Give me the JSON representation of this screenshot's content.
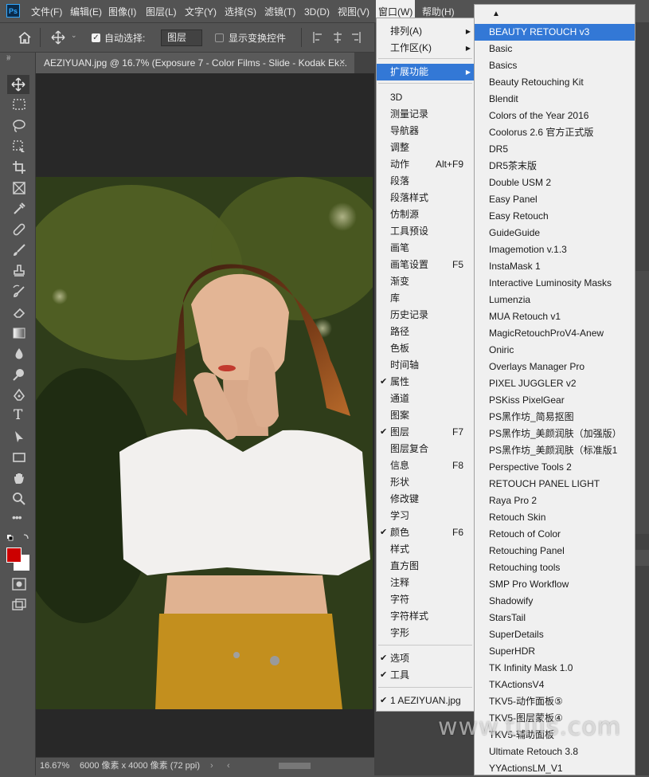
{
  "app": {
    "logo": "Ps"
  },
  "menubar": {
    "items": [
      "文件(F)",
      "编辑(E)",
      "图像(I)",
      "图层(L)",
      "文字(Y)",
      "选择(S)",
      "滤镜(T)",
      "3D(D)",
      "视图(V)",
      "窗口(W)",
      "帮助(H)"
    ],
    "active": "窗口(W)"
  },
  "options_bar": {
    "auto_select_label": "自动选择:",
    "auto_select_checked": true,
    "layer_select_value": "图层",
    "show_transform_label": "显示变换控件",
    "show_transform_checked": false
  },
  "document": {
    "tab_title": "AEZIYUAN.jpg @ 16.7% (Exposure 7 - Color Films - Slide - Kodak Ek...",
    "zoom": "16.67%",
    "dimensions": "6000 像素 x 4000 像素 (72 ppi)"
  },
  "colors": {
    "foreground": "#cc0000",
    "background": "#ffffff",
    "highlight": "#3378d6",
    "accent_blue": "#31a8ff"
  },
  "window_menu": {
    "items": [
      {
        "label": "排列(A)",
        "submenu": true
      },
      {
        "label": "工作区(K)",
        "submenu": true
      },
      {
        "label": "扩展功能",
        "submenu": true,
        "highlighted": true
      },
      {
        "label": "3D"
      },
      {
        "label": "测量记录"
      },
      {
        "label": "导航器"
      },
      {
        "label": "调整"
      },
      {
        "label": "动作",
        "shortcut": "Alt+F9"
      },
      {
        "label": "段落"
      },
      {
        "label": "段落样式"
      },
      {
        "label": "仿制源"
      },
      {
        "label": "工具预设"
      },
      {
        "label": "画笔"
      },
      {
        "label": "画笔设置",
        "shortcut": "F5"
      },
      {
        "label": "渐变"
      },
      {
        "label": "库"
      },
      {
        "label": "历史记录"
      },
      {
        "label": "路径"
      },
      {
        "label": "色板"
      },
      {
        "label": "时间轴"
      },
      {
        "label": "属性",
        "checked": true
      },
      {
        "label": "通道"
      },
      {
        "label": "图案"
      },
      {
        "label": "图层",
        "shortcut": "F7",
        "checked": true
      },
      {
        "label": "图层复合"
      },
      {
        "label": "信息",
        "shortcut": "F8"
      },
      {
        "label": "形状"
      },
      {
        "label": "修改键"
      },
      {
        "label": "学习"
      },
      {
        "label": "颜色",
        "shortcut": "F6",
        "checked": true
      },
      {
        "label": "样式"
      },
      {
        "label": "直方图"
      },
      {
        "label": "注释"
      },
      {
        "label": "字符"
      },
      {
        "label": "字符样式"
      },
      {
        "label": "字形"
      },
      {
        "label": "选项",
        "checked": true
      },
      {
        "label": "工具",
        "checked": true
      },
      {
        "label": "1 AEZIYUAN.jpg",
        "checked": true
      }
    ]
  },
  "extensions_submenu": {
    "scroll_up_glyph": "▲",
    "items": [
      "BEAUTY RETOUCH v3",
      "Basic",
      "Basics",
      "Beauty Retouching Kit",
      "Blendit",
      "Colors of the Year 2016",
      "Coolorus 2.6 官方正式版",
      "DR5",
      "DR5茶末版",
      "Double USM 2",
      "Easy Panel",
      "Easy Retouch",
      "GuideGuide",
      "Imagemotion v.1.3",
      "InstaMask 1",
      "Interactive Luminosity Masks",
      "Lumenzia",
      "MUA Retouch v1",
      "MagicRetouchProV4-Anew",
      "Oniric",
      "Overlays Manager Pro",
      "PIXEL JUGGLER v2",
      "PSKiss PixelGear",
      "PS黑作坊_简易抠图",
      "PS黑作坊_美颜润肤（加强版）",
      "PS黑作坊_美颜润肤（标准版1",
      "Perspective Tools 2",
      "RETOUCH PANEL LIGHT",
      "Raya Pro 2",
      "Retouch Skin",
      "Retouch of Color",
      "Retouching Panel",
      "Retouching tools",
      "SMP Pro Workflow",
      "Shadowify",
      "StarsTail",
      "SuperDetails",
      "SuperHDR",
      "TK Infinity Mask 1.0",
      "TKActionsV4",
      "TKV5-动作面板⑤",
      "TKV5-图层蒙板④",
      "TKV5-辅助面板",
      "Ultimate Retouch 3.8",
      "YYActionsLM_V1"
    ],
    "highlighted": "BEAUTY RETOUCH v3"
  },
  "watermark": "www.tuiis.com"
}
